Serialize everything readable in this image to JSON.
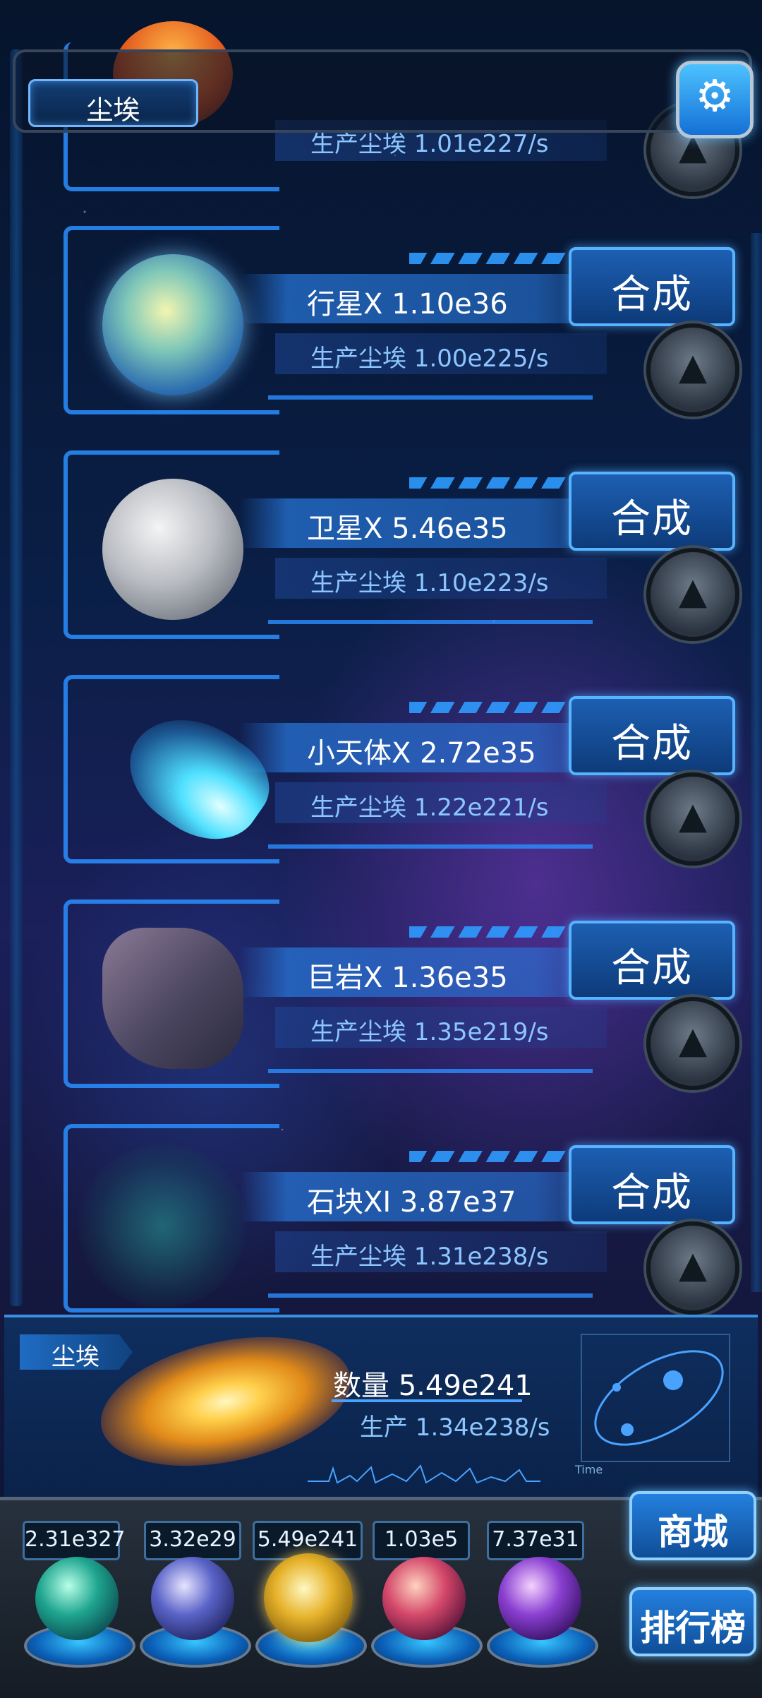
{
  "header": {
    "title": "尘埃",
    "settings_icon": "gear-icon"
  },
  "partial_item": {
    "rate": "生产尘埃  1.01e227/s"
  },
  "synth_label": "合成",
  "items": [
    {
      "name": "行星X 1.10e36",
      "rate": "生产尘埃  1.00e225/s",
      "icon": "planet-icon"
    },
    {
      "name": "卫星X 5.46e35",
      "rate": "生产尘埃  1.10e223/s",
      "icon": "moon-icon"
    },
    {
      "name": "小天体X 2.72e35",
      "rate": "生产尘埃  1.22e221/s",
      "icon": "comet-icon"
    },
    {
      "name": "巨岩X 1.36e35",
      "rate": "生产尘埃  1.35e219/s",
      "icon": "boulder-icon"
    },
    {
      "name": "石块XI 3.87e37",
      "rate": "生产尘埃  1.31e238/s",
      "icon": "rock-cluster-icon"
    }
  ],
  "dust_panel": {
    "tag": "尘埃",
    "quantity": "数量 5.49e241",
    "production": "生产 1.34e238/s",
    "chart_time_label": "Time"
  },
  "dock": {
    "values": [
      "2.31e327",
      "3.32e29",
      "5.49e241",
      "1.03e5",
      "7.37e31"
    ],
    "orbs": [
      "molecule-orb-icon",
      "lightning-orb-icon",
      "dust-orb-icon",
      "brain-orb-icon",
      "portal-orb-icon"
    ],
    "shop_label": "商城",
    "ranking_label": "排行榜"
  }
}
